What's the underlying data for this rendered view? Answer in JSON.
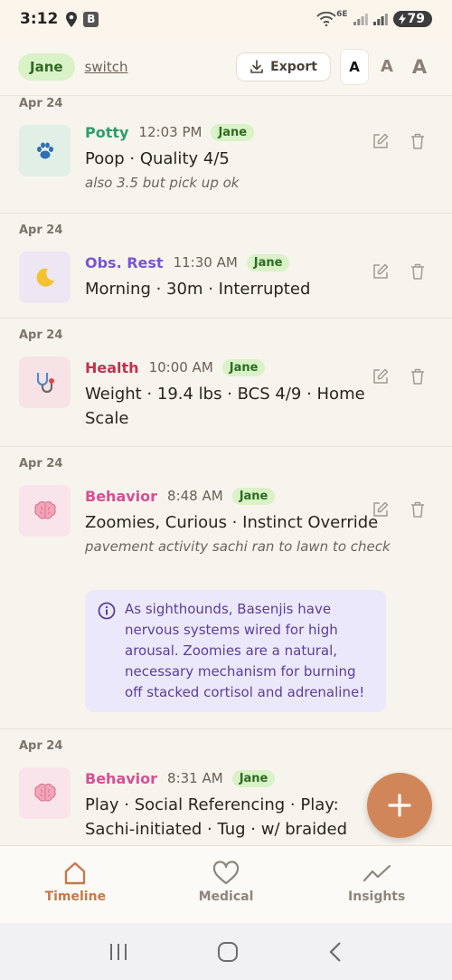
{
  "status_bar": {
    "time": "3:12",
    "network": "6E",
    "battery": "79"
  },
  "header": {
    "user": "Jane",
    "switch_label": "switch",
    "export_label": "Export",
    "font_sizes": [
      "A",
      "A",
      "A"
    ]
  },
  "entries": [
    {
      "date": "Apr 24",
      "icon": "paw-icon",
      "category": "Potty",
      "category_color": "#2e9e6a",
      "time": "12:03 PM",
      "who": "Jane",
      "detail": "Poop · Quality 4/5",
      "note": "also 3.5 but pick up ok"
    },
    {
      "date": "Apr 24",
      "icon": "moon-icon",
      "category": "Obs. Rest",
      "category_color": "#7a55d1",
      "time": "11:30 AM",
      "who": "Jane",
      "detail": "Morning · 30m · Interrupted"
    },
    {
      "date": "Apr 24",
      "icon": "stethoscope-icon",
      "category": "Health",
      "category_color": "#c2334f",
      "time": "10:00 AM",
      "who": "Jane",
      "detail": "Weight · 19.4 lbs · BCS 4/9 · Home Scale"
    },
    {
      "date": "Apr 24",
      "icon": "brain-icon",
      "category": "Behavior",
      "category_color": "#d64f93",
      "time": "8:48 AM",
      "who": "Jane",
      "detail": "Zoomies, Curious · Instinct Override",
      "note": "pavement activity sachi ran to lawn to check",
      "callout": "As sighthounds, Basenjis have nervous systems wired for high arousal. Zoomies are a natural, necessary mechanism for burning off stacked cortisol and adrenaline!"
    },
    {
      "date": "Apr 24",
      "icon": "brain-icon",
      "category": "Behavior",
      "category_color": "#d64f93",
      "time": "8:31 AM",
      "who": "Jane",
      "detail": "Play · Social Referencing · Play: Sachi-initiated · Tug · w/ braided"
    }
  ],
  "bottom_nav": [
    {
      "label": "Timeline",
      "icon": "home-icon",
      "active": true
    },
    {
      "label": "Medical",
      "icon": "heart-icon",
      "active": false
    },
    {
      "label": "Insights",
      "icon": "trend-icon",
      "active": false
    }
  ],
  "colors": {
    "accent": "#d1865a",
    "chip_bg": "#d9f2c7",
    "callout_bg": "#ece8fb"
  }
}
